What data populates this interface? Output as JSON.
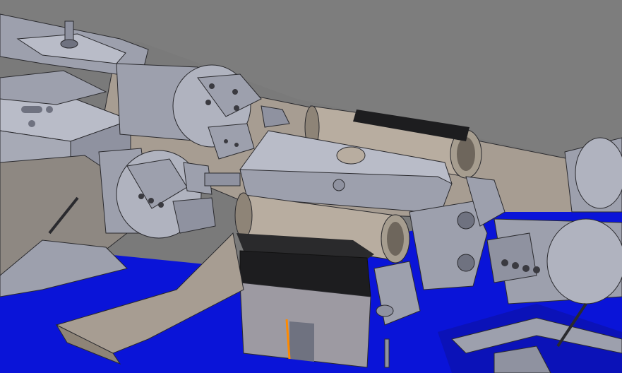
{
  "scene": {
    "kind": "cad-render",
    "colors": {
      "background": "#7a7a7a",
      "metal_light": "#b9bcc8",
      "metal_mid": "#9da0ad",
      "metal_dark": "#6f7280",
      "edge": "#2a2a2e",
      "tube_tan": "#b8ada0",
      "tube_shadow": "#8e8477",
      "base_blue": "#0a14d8",
      "block_black": "#1d1d1f",
      "accent_orange": "#ff8a00",
      "floor_beige": "#a79d92"
    }
  }
}
